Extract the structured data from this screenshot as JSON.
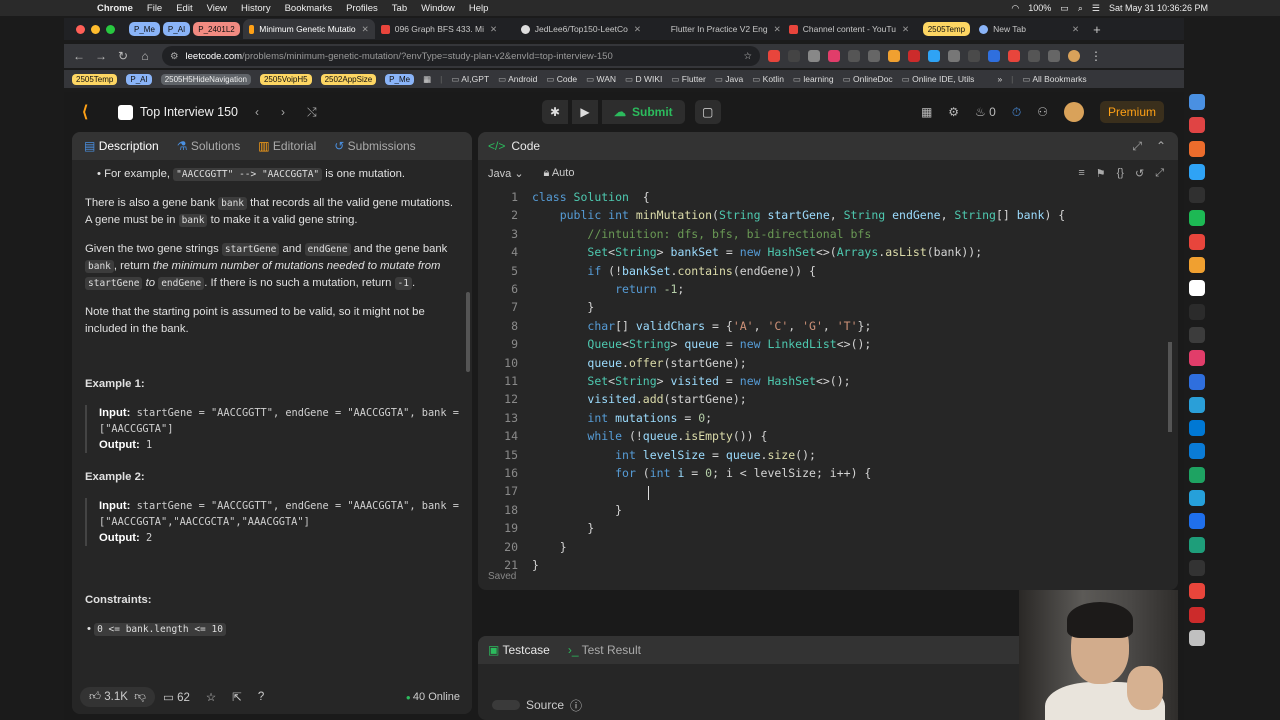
{
  "menubar": {
    "items": [
      "Chrome",
      "File",
      "Edit",
      "View",
      "History",
      "Bookmarks",
      "Profiles",
      "Tab",
      "Window",
      "Help"
    ],
    "battery": "100%",
    "clock": "Sat May 31  10:36:26 PM"
  },
  "tabs": {
    "groups": [
      {
        "label": "P_Me",
        "color": "#8ab4f8"
      },
      {
        "label": "P_AI",
        "color": "#8ab4f8"
      },
      {
        "label": "P_2401L2",
        "color": "#f28b82"
      }
    ],
    "list": [
      {
        "label": "Minimum Genetic Mutatio",
        "active": true
      },
      {
        "label": "096 Graph BFS 433. Mi",
        "active": false
      },
      {
        "label": "JedLee6/Top150-LeetCo",
        "active": false
      },
      {
        "label": "Flutter In Practice V2 Eng",
        "active": false
      },
      {
        "label": "Channel content - YouTu",
        "active": false
      },
      {
        "label": "2505Temp",
        "active": false
      },
      {
        "label": "New Tab",
        "active": false
      }
    ]
  },
  "address": {
    "host": "leetcode.com",
    "path": "/problems/minimum-genetic-mutation/?envType=study-plan-v2&envId=top-interview-150"
  },
  "bookmarks": {
    "tags": [
      {
        "label": "2505Temp",
        "color": "#fdd663"
      },
      {
        "label": "P_AI",
        "color": "#8ab4f8"
      },
      {
        "label": "2505H5HideNavigation",
        "color": "#5f6368"
      },
      {
        "label": "2505VoipH5",
        "color": "#fdd663"
      },
      {
        "label": "2502AppSize",
        "color": "#fdd663"
      },
      {
        "label": "P_Me",
        "color": "#8ab4f8"
      }
    ],
    "folders": [
      "AI,GPT",
      "Android",
      "Code",
      "WAN",
      "D WIKI",
      "Flutter",
      "Java",
      "Kotlin",
      "learning",
      "OnlineDoc",
      "Online IDE, Utils"
    ],
    "all": "All Bookmarks"
  },
  "lc": {
    "list_title": "Top Interview 150",
    "submit": "Submit",
    "streak": "0",
    "premium": "Premium",
    "left_tabs": [
      "Description",
      "Solutions",
      "Editorial",
      "Submissions"
    ],
    "desc": {
      "bullet_pre": "For example, ",
      "bullet_code1": "\"AACCGGTT\" --> \"AACCGGTA\"",
      "bullet_post": " is one mutation.",
      "p1_a": "There is also a gene bank ",
      "p1_code": "bank",
      "p1_b": " that records all the valid gene mutations. A gene must be in ",
      "p1_code2": "bank",
      "p1_c": " to make it a valid gene string.",
      "p2_a": "Given the two gene strings ",
      "p2_code1": "startGene",
      "p2_b": " and ",
      "p2_code2": "endGene",
      "p2_c": " and the gene bank ",
      "p2_code3": "bank",
      "p2_d": ", return ",
      "p2_em1": "the minimum number of mutations needed to mutate from ",
      "p2_code4": "startGene",
      "p2_em2": " to ",
      "p2_code5": "endGene",
      "p2_e": ". If there is no such a mutation, return ",
      "p2_code6": "-1",
      "p2_f": ".",
      "p3": "Note that the starting point is assumed to be valid, so it might not be included in the bank.",
      "ex1_title": "Example 1:",
      "ex1_input_lbl": "Input:",
      "ex1_input": " startGene = \"AACCGGTT\", endGene = \"AACCGGTA\", bank = [\"AACCGGTA\"]",
      "ex1_output_lbl": "Output:",
      "ex1_output": " 1",
      "ex2_title": "Example 2:",
      "ex2_input_lbl": "Input:",
      "ex2_input": " startGene = \"AACCGGTT\", endGene = \"AAACGGTA\", bank = [\"AACCGGTA\",\"AACCGCTA\",\"AAACGGTA\"]",
      "ex2_output_lbl": "Output:",
      "ex2_output": " 2",
      "constraints_title": "Constraints:",
      "constraint1": "0 <= bank.length <= 10"
    },
    "footer": {
      "likes": "3.1K",
      "comments": "62",
      "online": "40 Online"
    },
    "code_title": "Code",
    "language": "Java",
    "auto": "Auto",
    "saved": "Saved",
    "testcase_tab": "Testcase",
    "test_result_tab": "Test Result",
    "source": "Source"
  },
  "code_lines": [
    [
      [
        "kw",
        "class "
      ],
      [
        "ty",
        "Solution"
      ],
      [
        "",
        "  {"
      ]
    ],
    [
      [
        "",
        "    "
      ],
      [
        "kw",
        "public int "
      ],
      [
        "fn",
        "minMutation"
      ],
      [
        "",
        "("
      ],
      [
        "ty",
        "String "
      ],
      [
        "vr",
        "startGene"
      ],
      [
        "",
        ", "
      ],
      [
        "ty",
        "String "
      ],
      [
        "vr",
        "endGene"
      ],
      [
        "",
        ", "
      ],
      [
        "ty",
        "String"
      ],
      [
        "",
        "[] "
      ],
      [
        "vr",
        "bank"
      ],
      [
        "",
        ") {"
      ]
    ],
    [
      [
        "",
        "        "
      ],
      [
        "cm",
        "//intuition: dfs, bfs, bi-directional bfs"
      ]
    ],
    [
      [
        "",
        "        "
      ],
      [
        "ty",
        "Set"
      ],
      [
        "",
        "<"
      ],
      [
        "ty",
        "String"
      ],
      [
        "",
        "> "
      ],
      [
        "vr",
        "bankSet"
      ],
      [
        "",
        " = "
      ],
      [
        "kw",
        "new "
      ],
      [
        "ty",
        "HashSet"
      ],
      [
        "",
        "<>("
      ],
      [
        "ty",
        "Arrays"
      ],
      [
        "",
        "."
      ],
      [
        "fn",
        "asList"
      ],
      [
        "",
        "(bank));"
      ]
    ],
    [
      [
        "",
        "        "
      ],
      [
        "kw",
        "if "
      ],
      [
        "",
        "(!"
      ],
      [
        "vr",
        "bankSet"
      ],
      [
        "",
        "."
      ],
      [
        "fn",
        "contains"
      ],
      [
        "",
        "(endGene)) {"
      ]
    ],
    [
      [
        "",
        "            "
      ],
      [
        "kw",
        "return "
      ],
      [
        "nm",
        "-1"
      ],
      [
        "",
        ";"
      ]
    ],
    [
      [
        "",
        "        }"
      ]
    ],
    [
      [
        "",
        "        "
      ],
      [
        "kw",
        "char"
      ],
      [
        "",
        "[] "
      ],
      [
        "vr",
        "validChars"
      ],
      [
        "",
        " = {"
      ],
      [
        "st",
        "'A'"
      ],
      [
        "",
        ", "
      ],
      [
        "st",
        "'C'"
      ],
      [
        "",
        ", "
      ],
      [
        "st",
        "'G'"
      ],
      [
        "",
        ", "
      ],
      [
        "st",
        "'T'"
      ],
      [
        "",
        "};"
      ]
    ],
    [
      [
        "",
        "        "
      ],
      [
        "ty",
        "Queue"
      ],
      [
        "",
        "<"
      ],
      [
        "ty",
        "String"
      ],
      [
        "",
        "> "
      ],
      [
        "vr",
        "queue"
      ],
      [
        "",
        " = "
      ],
      [
        "kw",
        "new "
      ],
      [
        "ty",
        "LinkedList"
      ],
      [
        "",
        "<>();"
      ]
    ],
    [
      [
        "",
        "        "
      ],
      [
        "vr",
        "queue"
      ],
      [
        "",
        "."
      ],
      [
        "fn",
        "offer"
      ],
      [
        "",
        "(startGene);"
      ]
    ],
    [
      [
        "",
        "        "
      ],
      [
        "ty",
        "Set"
      ],
      [
        "",
        "<"
      ],
      [
        "ty",
        "String"
      ],
      [
        "",
        "> "
      ],
      [
        "vr",
        "visited"
      ],
      [
        "",
        " = "
      ],
      [
        "kw",
        "new "
      ],
      [
        "ty",
        "HashSet"
      ],
      [
        "",
        "<>();"
      ]
    ],
    [
      [
        "",
        "        "
      ],
      [
        "vr",
        "visited"
      ],
      [
        "",
        "."
      ],
      [
        "fn",
        "add"
      ],
      [
        "",
        "(startGene);"
      ]
    ],
    [
      [
        "",
        "        "
      ],
      [
        "kw",
        "int "
      ],
      [
        "vr",
        "mutations"
      ],
      [
        "",
        " = "
      ],
      [
        "nm",
        "0"
      ],
      [
        "",
        ";"
      ]
    ],
    [
      [
        "",
        "        "
      ],
      [
        "kw",
        "while "
      ],
      [
        "",
        "(!"
      ],
      [
        "vr",
        "queue"
      ],
      [
        "",
        "."
      ],
      [
        "fn",
        "isEmpty"
      ],
      [
        "",
        "()) {"
      ]
    ],
    [
      [
        "",
        "            "
      ],
      [
        "kw",
        "int "
      ],
      [
        "vr",
        "levelSize"
      ],
      [
        "",
        " = "
      ],
      [
        "vr",
        "queue"
      ],
      [
        "",
        "."
      ],
      [
        "fn",
        "size"
      ],
      [
        "",
        "();"
      ]
    ],
    [
      [
        "",
        "            "
      ],
      [
        "kw",
        "for "
      ],
      [
        "",
        "("
      ],
      [
        "kw",
        "int "
      ],
      [
        "vr",
        "i"
      ],
      [
        "",
        " = "
      ],
      [
        "nm",
        "0"
      ],
      [
        "",
        "; i < levelSize; i++) {"
      ]
    ],
    [
      [
        "",
        ""
      ]
    ],
    [
      [
        "",
        "            }"
      ]
    ],
    [
      [
        "",
        "        }"
      ]
    ],
    [
      [
        "",
        "    }"
      ]
    ],
    [
      [
        "",
        "}"
      ]
    ]
  ],
  "line_numbers": [
    "1",
    "2",
    "3",
    "4",
    "5",
    "6",
    "7",
    "8",
    "9",
    "10",
    "11",
    "12",
    "13",
    "14",
    "15",
    "16",
    "17",
    "18",
    "19",
    "20",
    "21"
  ],
  "dock_colors": [
    "#4a90e2",
    "#e04444",
    "#ec6c2c",
    "#2fa3f5",
    "#303030",
    "#1db954",
    "#e8453c",
    "#f0a030",
    "#ffffff",
    "#2b2b2b",
    "#3c3c3c",
    "#e13d6a",
    "#2f6fde",
    "#2a9fd8",
    "#0078d4",
    "#0a7bd6",
    "#1ea362",
    "#26a0da",
    "#1f6feb",
    "#1e9e7a",
    "#333333",
    "#e9453b",
    "#cc2b2b",
    "#c0c0c0"
  ]
}
